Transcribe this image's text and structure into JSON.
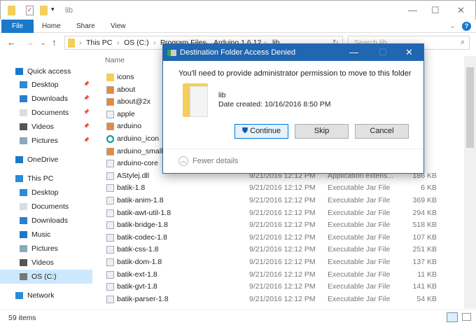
{
  "window": {
    "title": "lib",
    "minimize": "—",
    "maximize": "☐",
    "close": "✕"
  },
  "ribbon": {
    "tabs": [
      "File",
      "Home",
      "Share",
      "View"
    ],
    "help": "?",
    "expand": "⌄"
  },
  "address": {
    "crumbs": [
      "This PC",
      "OS (C:)",
      "Program Files",
      "Arduino 1.6.12",
      "lib"
    ],
    "search_placeholder": "Search lib"
  },
  "sidebar": [
    {
      "label": "Quick access",
      "indent": 0,
      "pinned": false,
      "icon": "star-icon"
    },
    {
      "label": "Desktop",
      "indent": 1,
      "pinned": true,
      "icon": "desktop-icon"
    },
    {
      "label": "Downloads",
      "indent": 1,
      "pinned": true,
      "icon": "download-icon"
    },
    {
      "label": "Documents",
      "indent": 1,
      "pinned": true,
      "icon": "documents-icon"
    },
    {
      "label": "Videos",
      "indent": 1,
      "pinned": true,
      "icon": "videos-icon"
    },
    {
      "label": "Pictures",
      "indent": 1,
      "pinned": true,
      "icon": "pictures-icon"
    },
    {
      "label": "OneDrive",
      "indent": 0,
      "pinned": false,
      "icon": "cloud-icon"
    },
    {
      "label": "This PC",
      "indent": 0,
      "pinned": false,
      "icon": "computer-icon"
    },
    {
      "label": "Desktop",
      "indent": 1,
      "pinned": false,
      "icon": "desktop-icon"
    },
    {
      "label": "Documents",
      "indent": 1,
      "pinned": false,
      "icon": "documents-icon"
    },
    {
      "label": "Downloads",
      "indent": 1,
      "pinned": false,
      "icon": "download-icon"
    },
    {
      "label": "Music",
      "indent": 1,
      "pinned": false,
      "icon": "music-icon"
    },
    {
      "label": "Pictures",
      "indent": 1,
      "pinned": false,
      "icon": "pictures-icon"
    },
    {
      "label": "Videos",
      "indent": 1,
      "pinned": false,
      "icon": "videos-icon"
    },
    {
      "label": "OS (C:)",
      "indent": 1,
      "pinned": false,
      "icon": "drive-icon",
      "selected": true
    },
    {
      "label": "Network",
      "indent": 0,
      "pinned": false,
      "icon": "network-icon"
    }
  ],
  "list": {
    "column_name": "Name",
    "rows": [
      {
        "name": "icons",
        "date": "",
        "type": "",
        "size": ""
      },
      {
        "name": "about",
        "date": "",
        "type": "",
        "size": ""
      },
      {
        "name": "about@2x",
        "date": "",
        "type": "",
        "size": ""
      },
      {
        "name": "apple",
        "date": "",
        "type": "",
        "size": ""
      },
      {
        "name": "arduino",
        "date": "",
        "type": "",
        "size": ""
      },
      {
        "name": "arduino_icon",
        "date": "",
        "type": "",
        "size": ""
      },
      {
        "name": "arduino_small",
        "date": "",
        "type": "",
        "size": ""
      },
      {
        "name": "arduino-core",
        "date": "",
        "type": "",
        "size": ""
      },
      {
        "name": "AStylej.dll",
        "date": "9/21/2016 12:12 PM",
        "type": "Application extens...",
        "size": "186 KB"
      },
      {
        "name": "batik-1.8",
        "date": "9/21/2016 12:12 PM",
        "type": "Executable Jar File",
        "size": "6 KB"
      },
      {
        "name": "batik-anim-1.8",
        "date": "9/21/2016 12:12 PM",
        "type": "Executable Jar File",
        "size": "369 KB"
      },
      {
        "name": "batik-awt-util-1.8",
        "date": "9/21/2016 12:12 PM",
        "type": "Executable Jar File",
        "size": "294 KB"
      },
      {
        "name": "batik-bridge-1.8",
        "date": "9/21/2016 12:12 PM",
        "type": "Executable Jar File",
        "size": "518 KB"
      },
      {
        "name": "batik-codec-1.8",
        "date": "9/21/2016 12:12 PM",
        "type": "Executable Jar File",
        "size": "107 KB"
      },
      {
        "name": "batik-css-1.8",
        "date": "9/21/2016 12:12 PM",
        "type": "Executable Jar File",
        "size": "251 KB"
      },
      {
        "name": "batik-dom-1.8",
        "date": "9/21/2016 12:12 PM",
        "type": "Executable Jar File",
        "size": "137 KB"
      },
      {
        "name": "batik-ext-1.8",
        "date": "9/21/2016 12:12 PM",
        "type": "Executable Jar File",
        "size": "11 KB"
      },
      {
        "name": "batik-gvt-1.8",
        "date": "9/21/2016 12:12 PM",
        "type": "Executable Jar File",
        "size": "141 KB"
      },
      {
        "name": "batik-parser-1.8",
        "date": "9/21/2016 12:12 PM",
        "type": "Executable Jar File",
        "size": "54 KB"
      }
    ]
  },
  "status": {
    "count": "59 items"
  },
  "dialog": {
    "title": "Destination Folder Access Denied",
    "message": "You'll need to provide administrator permission to move to this folder",
    "folder_name": "lib",
    "date_created": "Date created: 10/16/2016 8:50 PM",
    "continue": "Continue",
    "skip": "Skip",
    "cancel": "Cancel",
    "fewer_details": "Fewer details",
    "minimize": "—",
    "maximize": "☐",
    "close": "✕"
  }
}
